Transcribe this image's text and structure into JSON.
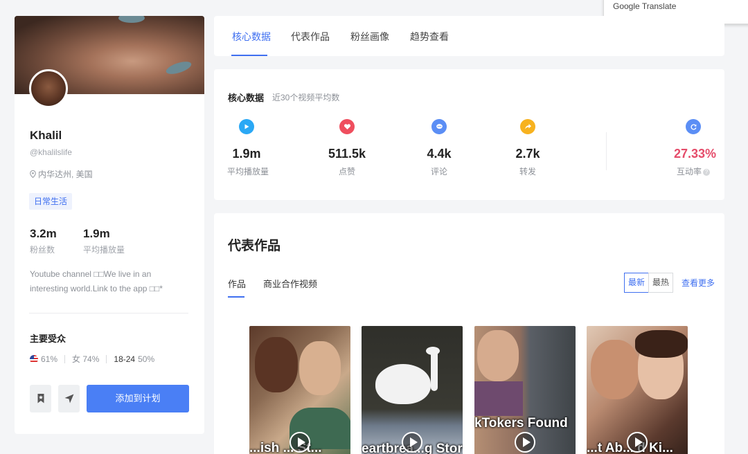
{
  "translate_popup": {
    "label": "Google Translate"
  },
  "profile": {
    "name": "Khalil",
    "handle": "@khalilslife",
    "location": "内华达州, 美国",
    "tag": "日常生活",
    "stats": [
      {
        "value": "3.2m",
        "label": "粉丝数"
      },
      {
        "value": "1.9m",
        "label": "平均播放量"
      }
    ],
    "description": "Youtube channel □□We live in an interesting world.Link to the app □□*",
    "audience": {
      "title": "主要受众",
      "country_pct": "61%",
      "gender": "女 74%",
      "age_range": "18-24",
      "age_pct": "50%"
    },
    "add_button": "添加到计划"
  },
  "tabs": [
    "核心数据",
    "代表作品",
    "粉丝画像",
    "趋势查看"
  ],
  "core": {
    "title": "核心数据",
    "subtitle": "近30个视频平均数",
    "metrics": [
      {
        "value": "1.9m",
        "label": "平均播放量",
        "icon": "play-icon",
        "color": "#2aa8f5"
      },
      {
        "value": "511.5k",
        "label": "点赞",
        "icon": "heart-icon",
        "color": "#ef4e5e"
      },
      {
        "value": "4.4k",
        "label": "评论",
        "icon": "comment-icon",
        "color": "#5b8ef5"
      },
      {
        "value": "2.7k",
        "label": "转发",
        "icon": "share-icon",
        "color": "#f7b21f"
      },
      {
        "value": "27.33%",
        "label": "互动率",
        "icon": "refresh-icon",
        "color": "#5b8ef5"
      }
    ]
  },
  "works": {
    "title": "代表作品",
    "tabs": [
      "作品",
      "商业合作视频"
    ],
    "sort": [
      "最新",
      "最热"
    ],
    "more": "查看更多",
    "videos": [
      {
        "caption": "...ish ... St..."
      },
      {
        "caption": "eartbrea...g Story 😢"
      },
      {
        "caption": "kTokers Found"
      },
      {
        "caption": "...t Ab... d Ki..."
      }
    ]
  }
}
